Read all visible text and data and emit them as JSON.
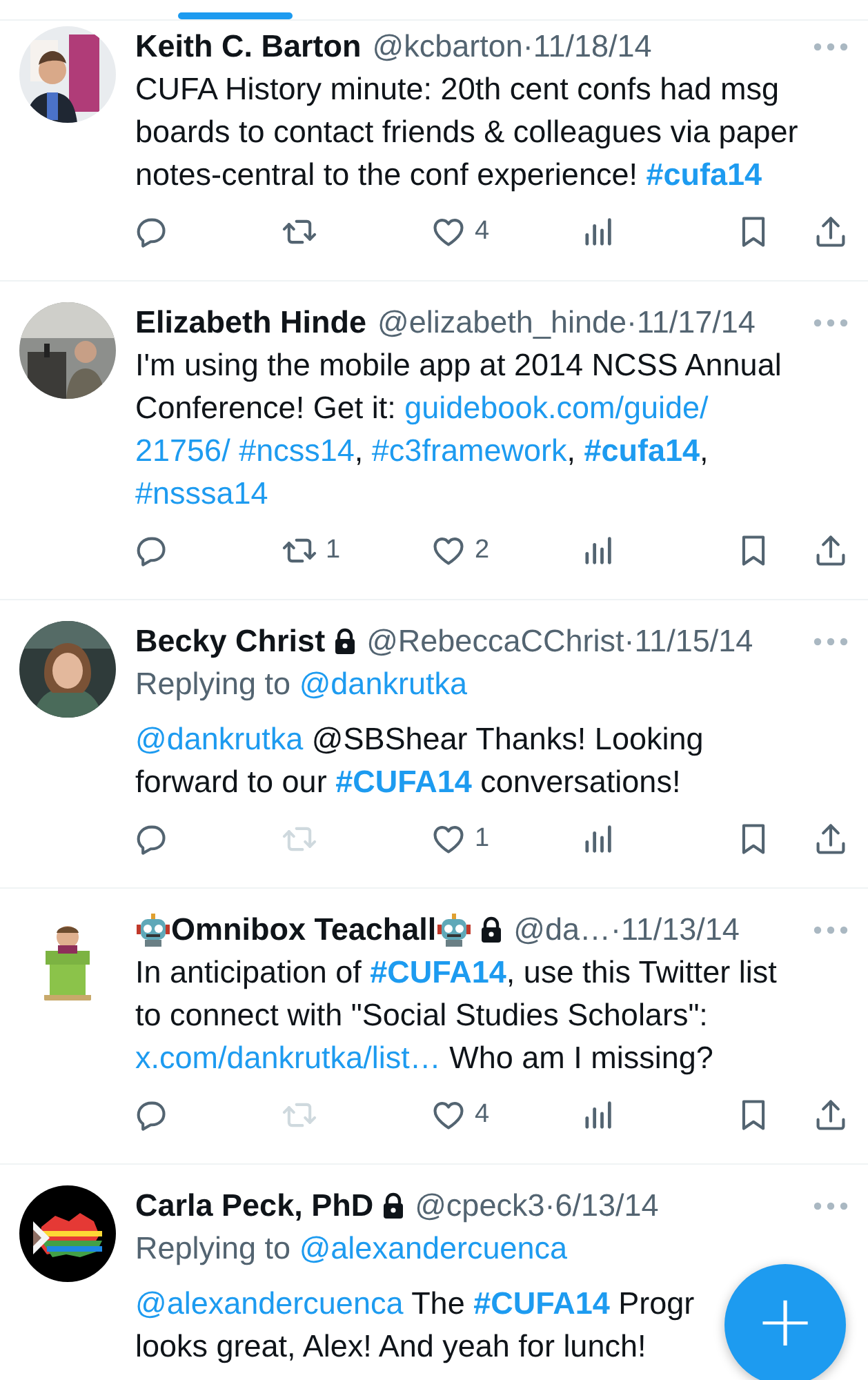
{
  "tabs_indicator": {
    "selected": true
  },
  "tweets": [
    {
      "avatar": {
        "kind": "picture"
      },
      "name": "Keith C. Barton",
      "robot_emoji": false,
      "protected": false,
      "handle": "@kcbarton",
      "date": "·11/18/14",
      "lines": [
        [
          {
            "kind": "plain",
            "text": "CUFA History minute: 20th cent confs had msg"
          }
        ],
        [
          {
            "kind": "plain",
            "text": "boards to contact friends & colleagues via paper"
          }
        ],
        [
          {
            "kind": "plain",
            "text": "notes-central to the conf experience! "
          },
          {
            "kind": "tag",
            "text": "#cufa14"
          }
        ]
      ],
      "actions": [
        {
          "kind": "reply",
          "disabled": false
        },
        {
          "kind": "retweet",
          "disabled": false
        },
        {
          "kind": "like",
          "count": "4",
          "disabled": false
        },
        {
          "kind": "views",
          "disabled": false
        },
        {
          "kind": "bookmark",
          "disabled": false
        },
        {
          "kind": "share",
          "disabled": false
        }
      ]
    },
    {
      "avatar": {
        "kind": "picture"
      },
      "name": "Elizabeth Hinde",
      "robot_emoji": false,
      "protected": false,
      "handle": "@elizabeth_hinde",
      "date": "·11/17/14",
      "lines": [
        [
          {
            "kind": "plain",
            "text": "I'm using the mobile app at 2014 NCSS Annual"
          }
        ],
        [
          {
            "kind": "plain",
            "text": "Conference! Get it: "
          },
          {
            "kind": "link",
            "text": "guidebook.com/guide/"
          }
        ],
        [
          {
            "kind": "link",
            "text": "21756/"
          },
          {
            "kind": "link",
            "text": "#ncss14",
            "space_before": true
          },
          {
            "kind": "plain",
            "text": ", "
          },
          {
            "kind": "link",
            "text": "#c3framework"
          },
          {
            "kind": "plain",
            "text": ", "
          },
          {
            "kind": "tag",
            "text": "#cufa14"
          },
          {
            "kind": "plain",
            "text": ","
          }
        ],
        [
          {
            "kind": "link",
            "text": "#nsssa14"
          }
        ]
      ],
      "actions": [
        {
          "kind": "reply",
          "disabled": false
        },
        {
          "kind": "retweet",
          "count": "1",
          "disabled": false
        },
        {
          "kind": "like",
          "count": "2",
          "disabled": false
        },
        {
          "kind": "views",
          "disabled": false
        },
        {
          "kind": "bookmark",
          "disabled": false
        },
        {
          "kind": "share",
          "disabled": false
        }
      ]
    },
    {
      "avatar": {
        "kind": "picture"
      },
      "name": "Becky Christ",
      "robot_emoji": false,
      "protected": true,
      "handle": "@RebeccaCChrist",
      "date": "·11/15/14",
      "replying_to": {
        "text": "Replying to",
        "handle": "@dankrutka"
      },
      "lines": [
        [
          {
            "kind": "link",
            "text": "@dankrutka"
          },
          {
            "kind": "plain",
            "text": " @SBShear Thanks! Looking"
          }
        ],
        [
          {
            "kind": "plain",
            "text": "forward to our "
          },
          {
            "kind": "tag",
            "text": "#CUFA14"
          },
          {
            "kind": "plain",
            "text": " conversations!"
          }
        ]
      ],
      "actions": [
        {
          "kind": "reply",
          "disabled": false
        },
        {
          "kind": "retweet",
          "disabled": true
        },
        {
          "kind": "like",
          "count": "1",
          "disabled": false
        },
        {
          "kind": "views",
          "disabled": false
        },
        {
          "kind": "bookmark",
          "disabled": false
        },
        {
          "kind": "share",
          "disabled": false
        }
      ]
    },
    {
      "avatar": {
        "kind": "picture"
      },
      "name": "Omnibox Teachall",
      "robot_emoji": true,
      "protected": true,
      "handle": "@da…",
      "date": "·11/13/14",
      "lines": [
        [
          {
            "kind": "plain",
            "text": "In anticipation of "
          },
          {
            "kind": "tag",
            "text": "#CUFA14"
          },
          {
            "kind": "plain",
            "text": ", use this Twitter list"
          }
        ],
        [
          {
            "kind": "plain",
            "text": "to connect with \"Social Studies Scholars\":"
          }
        ],
        [
          {
            "kind": "link",
            "text": "x.com/dankrutka/list…"
          },
          {
            "kind": "plain",
            "text": " Who am I missing?"
          }
        ]
      ],
      "actions": [
        {
          "kind": "reply",
          "disabled": false
        },
        {
          "kind": "retweet",
          "disabled": true
        },
        {
          "kind": "like",
          "count": "4",
          "disabled": false
        },
        {
          "kind": "views",
          "disabled": false
        },
        {
          "kind": "bookmark",
          "disabled": false
        },
        {
          "kind": "share",
          "disabled": false
        }
      ]
    },
    {
      "avatar": {
        "kind": "picture"
      },
      "name": "Carla Peck, PhD",
      "robot_emoji": false,
      "protected": true,
      "handle": "@cpeck3",
      "date": "·6/13/14",
      "replying_to": {
        "text": "Replying to",
        "handle": "@alexandercuenca"
      },
      "lines": [
        [
          {
            "kind": "link",
            "text": "@alexandercuenca"
          },
          {
            "kind": "plain",
            "text": " The "
          },
          {
            "kind": "tag",
            "text": "#CUFA14"
          },
          {
            "kind": "plain",
            "text": " Progr"
          }
        ],
        [
          {
            "kind": "plain",
            "text": "looks great, Alex! And yeah for lunch!"
          }
        ]
      ]
    }
  ],
  "compose_button": {
    "label": "+"
  }
}
